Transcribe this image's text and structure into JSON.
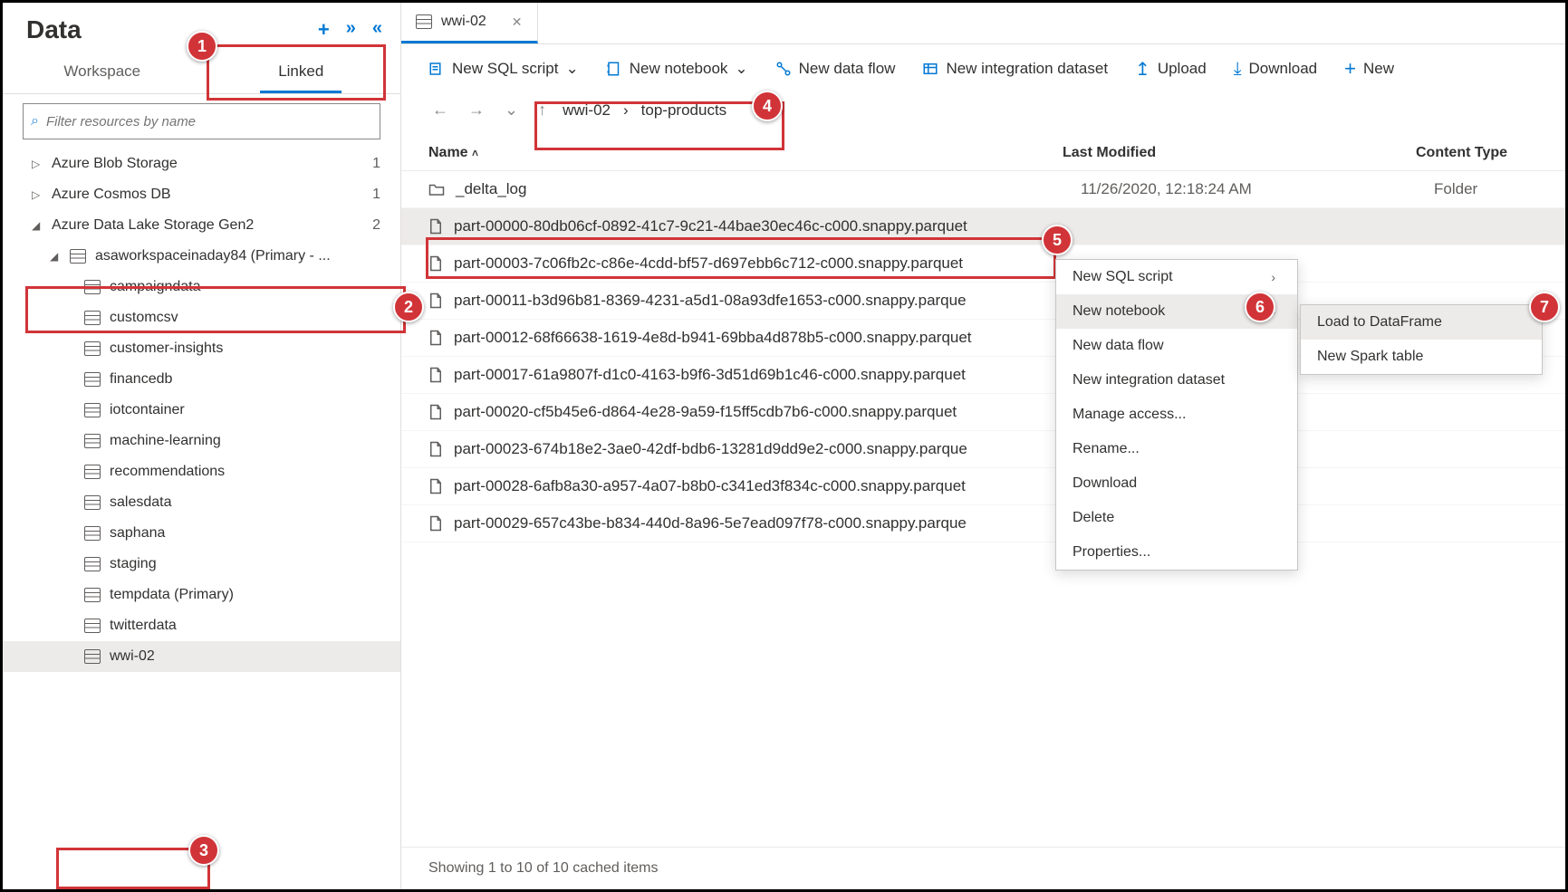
{
  "sidebar": {
    "title": "Data",
    "tabs": {
      "workspace": "Workspace",
      "linked": "Linked"
    },
    "search_placeholder": "Filter resources by name",
    "nodes": [
      {
        "label": "Azure Blob Storage",
        "count": "1",
        "expand": "▷",
        "level": 1
      },
      {
        "label": "Azure Cosmos DB",
        "count": "1",
        "expand": "▷",
        "level": 1
      },
      {
        "label": "Azure Data Lake Storage Gen2",
        "count": "2",
        "expand": "◢",
        "level": 1
      },
      {
        "label": "asaworkspaceinaday84 (Primary - ...",
        "count": "",
        "expand": "◢",
        "level": 2,
        "icon": "db"
      },
      {
        "label": "campaigndata",
        "level": 3,
        "icon": "db"
      },
      {
        "label": "customcsv",
        "level": 3,
        "icon": "db"
      },
      {
        "label": "customer-insights",
        "level": 3,
        "icon": "db"
      },
      {
        "label": "financedb",
        "level": 3,
        "icon": "db"
      },
      {
        "label": "iotcontainer",
        "level": 3,
        "icon": "db"
      },
      {
        "label": "machine-learning",
        "level": 3,
        "icon": "db"
      },
      {
        "label": "recommendations",
        "level": 3,
        "icon": "db"
      },
      {
        "label": "salesdata",
        "level": 3,
        "icon": "db"
      },
      {
        "label": "saphana",
        "level": 3,
        "icon": "db"
      },
      {
        "label": "staging",
        "level": 3,
        "icon": "db"
      },
      {
        "label": "tempdata (Primary)",
        "level": 3,
        "icon": "db"
      },
      {
        "label": "twitterdata",
        "level": 3,
        "icon": "db"
      },
      {
        "label": "wwi-02",
        "level": 3,
        "icon": "db",
        "selected": true
      }
    ]
  },
  "main": {
    "doctab": "wwi-02",
    "toolbar": {
      "new_sql": "New SQL script",
      "new_notebook": "New notebook",
      "new_dataflow": "New data flow",
      "new_dataset": "New integration dataset",
      "upload": "Upload",
      "download": "Download",
      "new": "New"
    },
    "breadcrumb": [
      "wwi-02",
      "top-products"
    ],
    "columns": {
      "name": "Name",
      "modified": "Last Modified",
      "type": "Content Type"
    },
    "files": [
      {
        "name": "_delta_log",
        "modified": "11/26/2020, 12:18:24 AM",
        "type": "Folder",
        "kind": "folder"
      },
      {
        "name": "part-00000-80db06cf-0892-41c7-9c21-44bae30ec46c-c000.snappy.parquet",
        "modified": "",
        "type": "",
        "kind": "file",
        "selected": true
      },
      {
        "name": "part-00003-7c06fb2c-c86e-4cdd-bf57-d697ebb6c712-c000.snappy.parquet",
        "modified": "",
        "type": "",
        "kind": "file"
      },
      {
        "name": "part-00011-b3d96b81-8369-4231-a5d1-08a93dfe1653-c000.snappy.parque",
        "modified": "",
        "type": "",
        "kind": "file"
      },
      {
        "name": "part-00012-68f66638-1619-4e8d-b941-69bba4d878b5-c000.snappy.parquet",
        "modified": "",
        "type": "",
        "kind": "file"
      },
      {
        "name": "part-00017-61a9807f-d1c0-4163-b9f6-3d51d69b1c46-c000.snappy.parquet",
        "modified": "",
        "type": "",
        "kind": "file"
      },
      {
        "name": "part-00020-cf5b45e6-d864-4e28-9a59-f15ff5cdb7b6-c000.snappy.parquet",
        "modified": "",
        "type": "",
        "kind": "file"
      },
      {
        "name": "part-00023-674b18e2-3ae0-42df-bdb6-13281d9dd9e2-c000.snappy.parque",
        "modified": "",
        "type": "",
        "kind": "file"
      },
      {
        "name": "part-00028-6afb8a30-a957-4a07-b8b0-c341ed3f834c-c000.snappy.parquet",
        "modified": "",
        "type": "",
        "kind": "file"
      },
      {
        "name": "part-00029-657c43be-b834-440d-8a96-5e7ead097f78-c000.snappy.parque",
        "modified": "",
        "type": "",
        "kind": "file"
      }
    ],
    "footer": "Showing 1 to 10 of 10 cached items"
  },
  "context_menu": {
    "items": [
      {
        "label": "New SQL script",
        "submenu": true
      },
      {
        "label": "New notebook",
        "submenu": true,
        "highlighted": true
      },
      {
        "label": "New data flow"
      },
      {
        "label": "New integration dataset"
      },
      {
        "label": "Manage access..."
      },
      {
        "label": "Rename..."
      },
      {
        "label": "Download"
      },
      {
        "label": "Delete"
      },
      {
        "label": "Properties..."
      }
    ],
    "submenu": [
      {
        "label": "Load to DataFrame",
        "highlighted": true
      },
      {
        "label": "New Spark table"
      }
    ]
  },
  "callouts": [
    "1",
    "2",
    "3",
    "4",
    "5",
    "6",
    "7"
  ]
}
